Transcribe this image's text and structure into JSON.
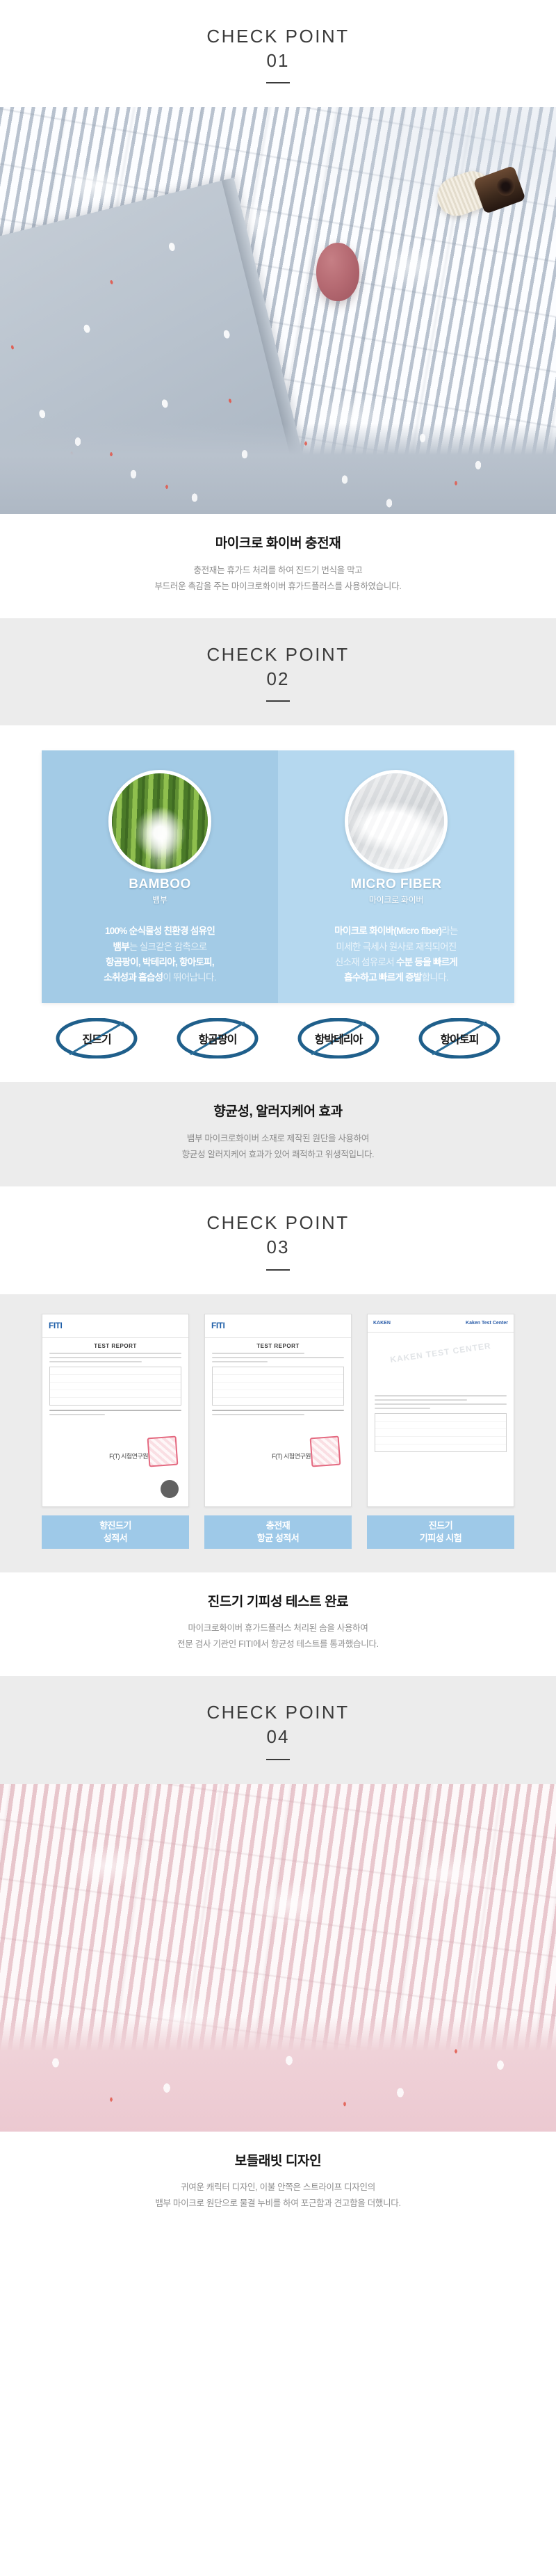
{
  "sections": [
    {
      "id": "01",
      "header": {
        "title": "CHECK POINT",
        "number": "01"
      },
      "text": {
        "heading": "마이크로 화이버 충전재",
        "body_line1": "충전재는 휴가드 처리를 하여 진드기 번식을 막고",
        "body_line2": "부드러운 촉감을 주는 마이크로화이버 휴가드플러스를 사용하였습니다."
      }
    },
    {
      "id": "02",
      "header": {
        "title": "CHECK POINT",
        "number": "02"
      },
      "panel": {
        "left": {
          "caption_en": "BAMBOO",
          "caption_kr": "뱀부",
          "desc_line1_bold": "100% 순식물성 친환경 섬유인",
          "desc_line2_bold": "뱀부",
          "desc_line2_soft": "는 실크같은 감촉으로",
          "desc_line3_bold": "항곰팡이, 박테리아, 항아토피,",
          "desc_line4_bold": "소취성과 흡습성",
          "desc_line4_soft": "이 뛰어납니다."
        },
        "right": {
          "caption_en": "MICRO FIBER",
          "caption_kr": "마이크로 화이버",
          "desc_line1_bold": "마이크로 화이바(Micro fiber)",
          "desc_line1_soft": "라는",
          "desc_line2_soft": "미세한 극세사 원사로 재직되어진",
          "desc_line3_soft": "신소재 섬유로서 ",
          "desc_line3_bold": "수분 등을 빠르게",
          "desc_line4_bold": "흡수하고 빠르게 증발",
          "desc_line4_soft": "합니다."
        }
      },
      "badges": [
        {
          "label": "진드기"
        },
        {
          "label": "항곰팡이"
        },
        {
          "label": "항박테리아"
        },
        {
          "label": "항아토피"
        }
      ],
      "text": {
        "heading": "향균성, 알러지케어 효과",
        "body_line1": "뱀부 마이크로화이버 소재로 제작된 원단을 사용하여",
        "body_line2": "향균성 알러지케어 효과가 있어 쾌적하고 위생적입니다."
      }
    },
    {
      "id": "03",
      "header": {
        "title": "CHECK POINT",
        "number": "03"
      },
      "reports": [
        {
          "logo": "FITI",
          "doc_title": "TEST REPORT",
          "sign": "F(T) 시험연구원",
          "caption_line1": "향진드기",
          "caption_line2": "성적서"
        },
        {
          "logo": "FITI",
          "doc_title": "TEST REPORT",
          "sign": "F(T) 시험연구원",
          "caption_line1": "충전재",
          "caption_line2": "항균 성적서"
        },
        {
          "logo": "KAKEN",
          "doc_title": "Kaken Test Center",
          "watermark": "KAKEN TEST CENTER",
          "caption_line1": "진드기",
          "caption_line2": "기피성 시험"
        }
      ],
      "text": {
        "heading": "진드기 기피성 테스트 완료",
        "body_line1": "마이크로화이버 휴가드플러스 처리된 솜을 사용하여",
        "body_line2": "전문 검사 기관인 FITI에서 향균성 테스트를 통과했습니다."
      }
    },
    {
      "id": "04",
      "header": {
        "title": "CHECK POINT",
        "number": "04"
      },
      "text": {
        "heading": "보들래빗 디자인",
        "body_line1": "귀여운 캐릭터 디자인, 이불 안쪽은 스트라이프 디자인의",
        "body_line2": "뱀부 마이크로 원단으로 물결 누비를 하여 포근함과 견고함을 더했니다."
      }
    }
  ],
  "colors": {
    "gray_band": "#ececec",
    "panel_left_blue": "#a3cbe6",
    "panel_right_blue": "#b5d8ef",
    "badge_blue": "#1f5f8b",
    "caption_blue": "#9ec9e8",
    "heading_dark": "#141414",
    "body_gray": "#8d8d8d"
  }
}
